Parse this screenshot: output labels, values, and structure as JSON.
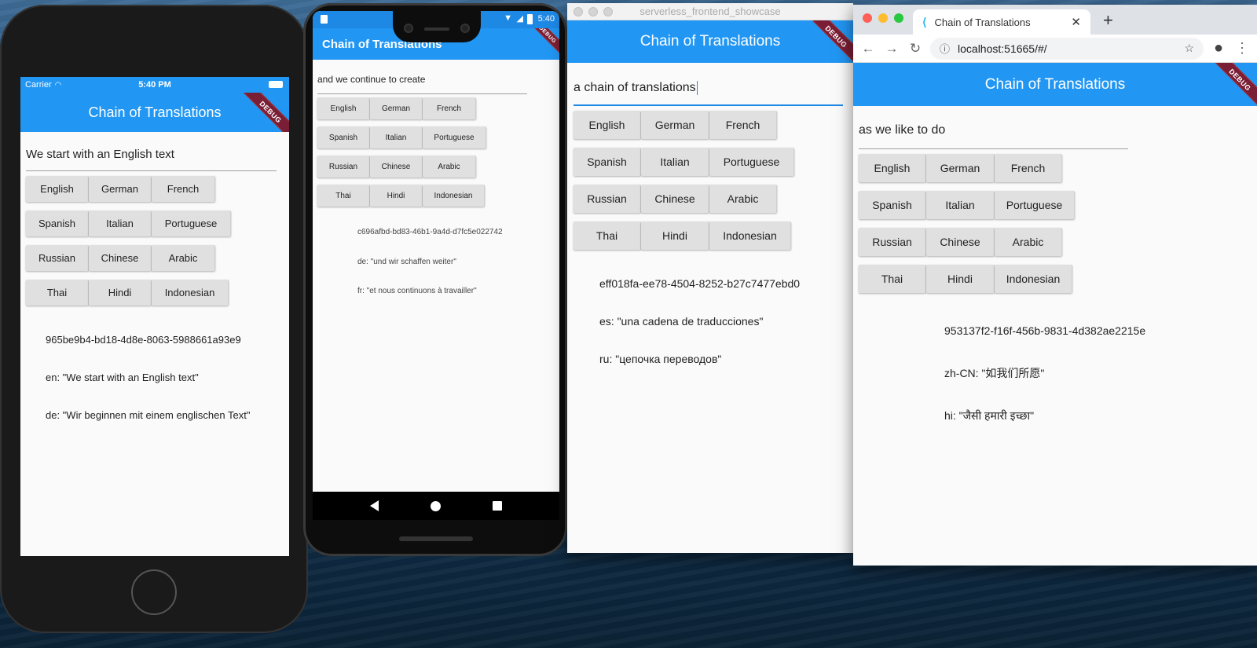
{
  "app": {
    "title": "Chain of Translations",
    "debug_label": "DEBUG",
    "languages": [
      [
        "English",
        "German",
        "French"
      ],
      [
        "Spanish",
        "Italian",
        "Portuguese"
      ],
      [
        "Russian",
        "Chinese",
        "Arabic"
      ],
      [
        "Thai",
        "Hindi",
        "Indonesian"
      ]
    ]
  },
  "ios": {
    "carrier": "Carrier",
    "time": "5:40 PM",
    "input_text": "We start with an English text",
    "result": {
      "id": "965be9b4-bd18-4d8e-8063-5988661a93e9",
      "line1": "en: \"We start with an English text\"",
      "line2": "de: \"Wir beginnen mit einem englischen Text\""
    }
  },
  "android": {
    "time": "5:40",
    "input_text": "and we continue to create",
    "result": {
      "id": "c696afbd-bd83-46b1-9a4d-d7fc5e022742",
      "line1": "de: \"und wir schaffen weiter\"",
      "line2": "fr: \"et nous continuons à travailler\""
    }
  },
  "macos": {
    "window_title": "serverless_frontend_showcase",
    "input_text": "a chain of translations",
    "result": {
      "id": "eff018fa-ee78-4504-8252-b27c7477ebd0",
      "line1": "es: \"una cadena de traducciones\"",
      "line2": "ru: \"цепочка переводов\""
    }
  },
  "chrome": {
    "tab_title": "Chain of Translations",
    "url": "localhost:51665/#/",
    "input_text": "as we like to do",
    "result": {
      "id": "953137f2-f16f-456b-9831-4d382ae2215e",
      "line1": "zh-CN: \"如我们所愿\"",
      "line2": "hi: \"जैसी हमारी इच्छा\""
    }
  },
  "colors": {
    "appbar": "#2196f3",
    "button": "#e0e0e0",
    "debug": "#7a1e35",
    "focus": "#1e88e5"
  }
}
